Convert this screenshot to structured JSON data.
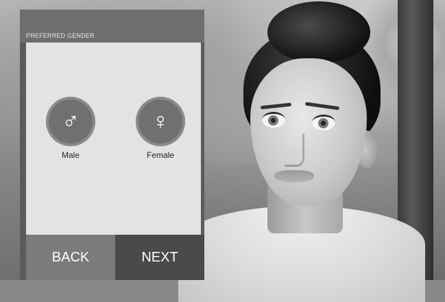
{
  "panel": {
    "title": "PREFERRED GENDER",
    "options": [
      {
        "label": "Male",
        "symbol": "♂"
      },
      {
        "label": "Female",
        "symbol": "♀"
      }
    ]
  },
  "navigation": {
    "back_label": "BACK",
    "next_label": "NEXT"
  },
  "icons": {
    "male": "male-symbol-icon",
    "female": "female-symbol-icon"
  },
  "colors": {
    "panel_bg": "#5b5b5b",
    "panel_body": "#e3e3e3",
    "button": "#707070",
    "back_button": "#7b7b7b",
    "next_button": "#4a4a4a"
  }
}
